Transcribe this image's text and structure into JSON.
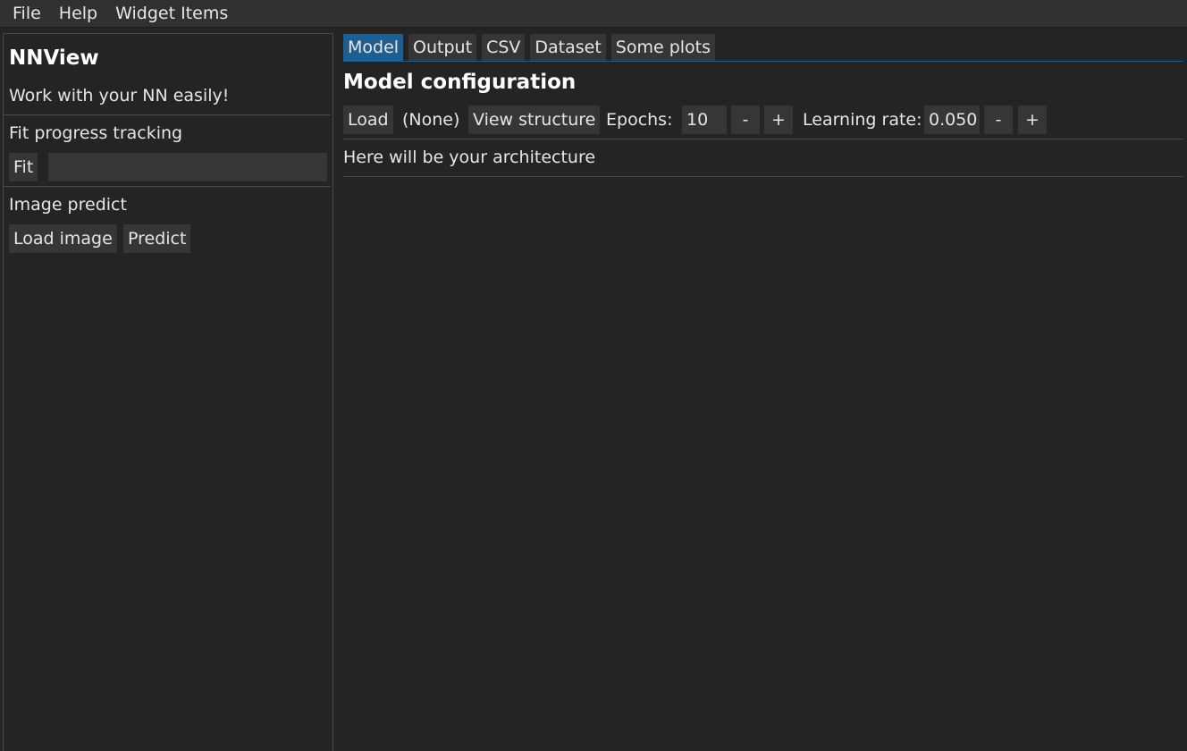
{
  "menubar": {
    "items": [
      "File",
      "Help",
      "Widget Items"
    ]
  },
  "sidebar": {
    "title": "NNView",
    "subtitle": "Work with your NN easily!",
    "fit_section": {
      "label": "Fit progress tracking",
      "fit_button": "Fit",
      "progress": 0
    },
    "predict_section": {
      "label": "Image predict",
      "load_image_button": "Load image",
      "predict_button": "Predict"
    }
  },
  "main": {
    "tabs": [
      {
        "label": "Model",
        "active": true
      },
      {
        "label": "Output",
        "active": false
      },
      {
        "label": "CSV",
        "active": false
      },
      {
        "label": "Dataset",
        "active": false
      },
      {
        "label": "Some plots",
        "active": false
      }
    ],
    "section_title": "Model configuration",
    "toolbar": {
      "load_button": "Load",
      "model_name": "(None)",
      "view_structure_button": "View structure",
      "epochs_label": "Epochs:",
      "epochs_value": "10",
      "epochs_minus": "-",
      "epochs_plus": "+",
      "lr_label": "Learning rate:",
      "lr_value": "0.050",
      "lr_minus": "-",
      "lr_plus": "+"
    },
    "architecture_text": "Here will be your architecture"
  },
  "colors": {
    "background": "#242424",
    "menubar": "#313131",
    "widget": "#363636",
    "accent": "#1f5e8e",
    "text": "#e6e6e6"
  }
}
